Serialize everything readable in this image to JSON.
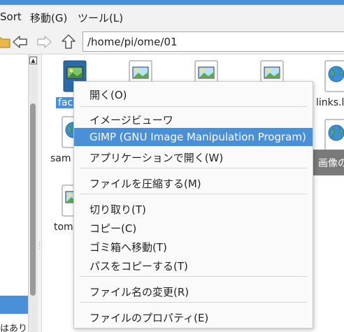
{
  "menubar": {
    "sort": "Sort",
    "go": "移動(G)",
    "tools": "ツール(L)"
  },
  "toolbar": {
    "path": "/home/pi/ome/01",
    "icons": [
      "folder-icon",
      "back-icon",
      "forward-icon",
      "up-icon"
    ]
  },
  "left_pane": {
    "partial_text": "はあり"
  },
  "files": [
    {
      "label": "fac",
      "selected": true,
      "icon": "image-file-icon"
    },
    {
      "label": "links.l",
      "icon": "globe-file-icon"
    },
    {
      "label": "sam",
      "icon": "globe-file-icon"
    },
    {
      "label": "tom",
      "icon": "image-file-icon"
    }
  ],
  "tooltip": "画像の",
  "context_menu": {
    "items": [
      {
        "label": "開く(O)"
      },
      {
        "label": "イメージビューワ"
      },
      {
        "label": "GIMP (GNU Image Manipulation Program)",
        "highlighted": true
      },
      {
        "label": "アプリケーションで開く(W)"
      },
      {
        "label": "ファイルを圧縮する(M)"
      },
      {
        "label": "切り取り(T)"
      },
      {
        "label": "コピー(C)"
      },
      {
        "label": "ゴミ箱へ移動(T)"
      },
      {
        "label": "パスをコピーする(T)"
      },
      {
        "label": "ファイル名の変更(R)"
      },
      {
        "label": "ファイルのプロパティ(E)"
      }
    ]
  },
  "colors": {
    "accent": "#4a90d9",
    "menu_bg": "#fafafa",
    "toolbar_bg": "#f2f2f2"
  }
}
